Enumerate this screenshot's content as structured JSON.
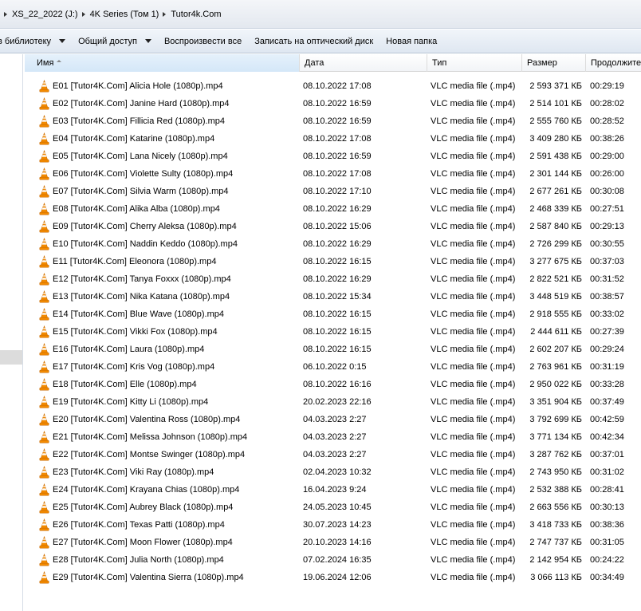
{
  "breadcrumb": [
    "XS_22_2022 (J:)",
    "4K Series (Том 1)",
    "Tutor4k.Com"
  ],
  "toolbar": {
    "library": "в библиотеку",
    "share": "Общий доступ",
    "play_all": "Воспроизвести все",
    "burn": "Записать на оптический диск",
    "new_folder": "Новая папка"
  },
  "columns": {
    "name": "Имя",
    "date": "Дата",
    "type": "Тип",
    "size": "Размер",
    "duration": "Продолжите"
  },
  "files": [
    {
      "name": "E01 [Tutor4K.Com] Alicia Hole (1080p).mp4",
      "date": "08.10.2022 17:08",
      "type": "VLC media file (.mp4)",
      "size": "2 593 371 КБ",
      "duration": "00:29:19"
    },
    {
      "name": "E02 [Tutor4K.Com] Janine Hard (1080p).mp4",
      "date": "08.10.2022 16:59",
      "type": "VLC media file (.mp4)",
      "size": "2 514 101 КБ",
      "duration": "00:28:02"
    },
    {
      "name": "E03 [Tutor4K.Com] Fillicia Red (1080p).mp4",
      "date": "08.10.2022 16:59",
      "type": "VLC media file (.mp4)",
      "size": "2 555 760 КБ",
      "duration": "00:28:52"
    },
    {
      "name": "E04 [Tutor4K.Com] Katarine (1080p).mp4",
      "date": "08.10.2022 17:08",
      "type": "VLC media file (.mp4)",
      "size": "3 409 280 КБ",
      "duration": "00:38:26"
    },
    {
      "name": "E05 [Tutor4K.Com] Lana Nicely (1080p).mp4",
      "date": "08.10.2022 16:59",
      "type": "VLC media file (.mp4)",
      "size": "2 591 438 КБ",
      "duration": "00:29:00"
    },
    {
      "name": "E06 [Tutor4K.Com] Violette Sulty (1080p).mp4",
      "date": "08.10.2022 17:08",
      "type": "VLC media file (.mp4)",
      "size": "2 301 144 КБ",
      "duration": "00:26:00"
    },
    {
      "name": "E07 [Tutor4K.Com] Silvia Warm (1080p).mp4",
      "date": "08.10.2022 17:10",
      "type": "VLC media file (.mp4)",
      "size": "2 677 261 КБ",
      "duration": "00:30:08"
    },
    {
      "name": "E08 [Tutor4K.Com] Alika Alba (1080p).mp4",
      "date": "08.10.2022 16:29",
      "type": "VLC media file (.mp4)",
      "size": "2 468 339 КБ",
      "duration": "00:27:51"
    },
    {
      "name": "E09 [Tutor4K.Com] Cherry Aleksa (1080p).mp4",
      "date": "08.10.2022 15:06",
      "type": "VLC media file (.mp4)",
      "size": "2 587 840 КБ",
      "duration": "00:29:13"
    },
    {
      "name": "E10 [Tutor4K.Com] Naddin Keddo (1080p).mp4",
      "date": "08.10.2022 16:29",
      "type": "VLC media file (.mp4)",
      "size": "2 726 299 КБ",
      "duration": "00:30:55"
    },
    {
      "name": "E11 [Tutor4K.Com] Eleonora (1080p).mp4",
      "date": "08.10.2022 16:15",
      "type": "VLC media file (.mp4)",
      "size": "3 277 675 КБ",
      "duration": "00:37:03"
    },
    {
      "name": "E12 [Tutor4K.Com] Tanya Foxxx (1080p).mp4",
      "date": "08.10.2022 16:29",
      "type": "VLC media file (.mp4)",
      "size": "2 822 521 КБ",
      "duration": "00:31:52"
    },
    {
      "name": "E13 [Tutor4K.Com] Nika Katana (1080p).mp4",
      "date": "08.10.2022 15:34",
      "type": "VLC media file (.mp4)",
      "size": "3 448 519 КБ",
      "duration": "00:38:57"
    },
    {
      "name": "E14 [Tutor4K.Com] Blue Wave (1080p).mp4",
      "date": "08.10.2022 16:15",
      "type": "VLC media file (.mp4)",
      "size": "2 918 555 КБ",
      "duration": "00:33:02"
    },
    {
      "name": "E15 [Tutor4K.Com] Vikki Fox (1080p).mp4",
      "date": "08.10.2022 16:15",
      "type": "VLC media file (.mp4)",
      "size": "2 444 611 КБ",
      "duration": "00:27:39"
    },
    {
      "name": "E16 [Tutor4K.Com] Laura (1080p).mp4",
      "date": "08.10.2022 16:15",
      "type": "VLC media file (.mp4)",
      "size": "2 602 207 КБ",
      "duration": "00:29:24"
    },
    {
      "name": "E17 [Tutor4K.Com] Kris Vog (1080p).mp4",
      "date": "06.10.2022 0:15",
      "type": "VLC media file (.mp4)",
      "size": "2 763 961 КБ",
      "duration": "00:31:19"
    },
    {
      "name": "E18 [Tutor4K.Com] Elle (1080p).mp4",
      "date": "08.10.2022 16:16",
      "type": "VLC media file (.mp4)",
      "size": "2 950 022 КБ",
      "duration": "00:33:28"
    },
    {
      "name": "E19 [Tutor4K.Com] Kitty Li (1080p).mp4",
      "date": "20.02.2023 22:16",
      "type": "VLC media file (.mp4)",
      "size": "3 351 904 КБ",
      "duration": "00:37:49"
    },
    {
      "name": "E20 [Tutor4K.Com] Valentina Ross (1080p).mp4",
      "date": "04.03.2023 2:27",
      "type": "VLC media file (.mp4)",
      "size": "3 792 699 КБ",
      "duration": "00:42:59"
    },
    {
      "name": "E21 [Tutor4K.Com] Melissa Johnson (1080p).mp4",
      "date": "04.03.2023 2:27",
      "type": "VLC media file (.mp4)",
      "size": "3 771 134 КБ",
      "duration": "00:42:34"
    },
    {
      "name": "E22 [Tutor4K.Com] Montse Swinger (1080p).mp4",
      "date": "04.03.2023 2:27",
      "type": "VLC media file (.mp4)",
      "size": "3 287 762 КБ",
      "duration": "00:37:01"
    },
    {
      "name": "E23 [Tutor4K.Com] Viki Ray (1080p).mp4",
      "date": "02.04.2023 10:32",
      "type": "VLC media file (.mp4)",
      "size": "2 743 950 КБ",
      "duration": "00:31:02"
    },
    {
      "name": "E24 [Tutor4K.Com] Krayana Chias (1080p).mp4",
      "date": "16.04.2023 9:24",
      "type": "VLC media file (.mp4)",
      "size": "2 532 388 КБ",
      "duration": "00:28:41"
    },
    {
      "name": "E25 [Tutor4K.Com] Aubrey Black (1080p).mp4",
      "date": "24.05.2023 10:45",
      "type": "VLC media file (.mp4)",
      "size": "2 663 556 КБ",
      "duration": "00:30:13"
    },
    {
      "name": "E26 [Tutor4K.Com] Texas Patti (1080p).mp4",
      "date": "30.07.2023 14:23",
      "type": "VLC media file (.mp4)",
      "size": "3 418 733 КБ",
      "duration": "00:38:36"
    },
    {
      "name": "E27 [Tutor4K.Com] Moon Flower (1080p).mp4",
      "date": "20.10.2023 14:16",
      "type": "VLC media file (.mp4)",
      "size": "2 747 737 КБ",
      "duration": "00:31:05"
    },
    {
      "name": "E28 [Tutor4K.Com] Julia North (1080p).mp4",
      "date": "07.02.2024 16:35",
      "type": "VLC media file (.mp4)",
      "size": "2 142 954 КБ",
      "duration": "00:24:22"
    },
    {
      "name": "E29 [Tutor4K.Com] Valentina Sierra (1080p).mp4",
      "date": "19.06.2024 12:06",
      "type": "VLC media file (.mp4)",
      "size": "3 066 113 КБ",
      "duration": "00:34:49"
    }
  ],
  "icons": {
    "file": "vlc-cone-icon"
  },
  "colors": {
    "vlc_orange": "#f48b00",
    "header_sorted": "#d4e7f8"
  }
}
